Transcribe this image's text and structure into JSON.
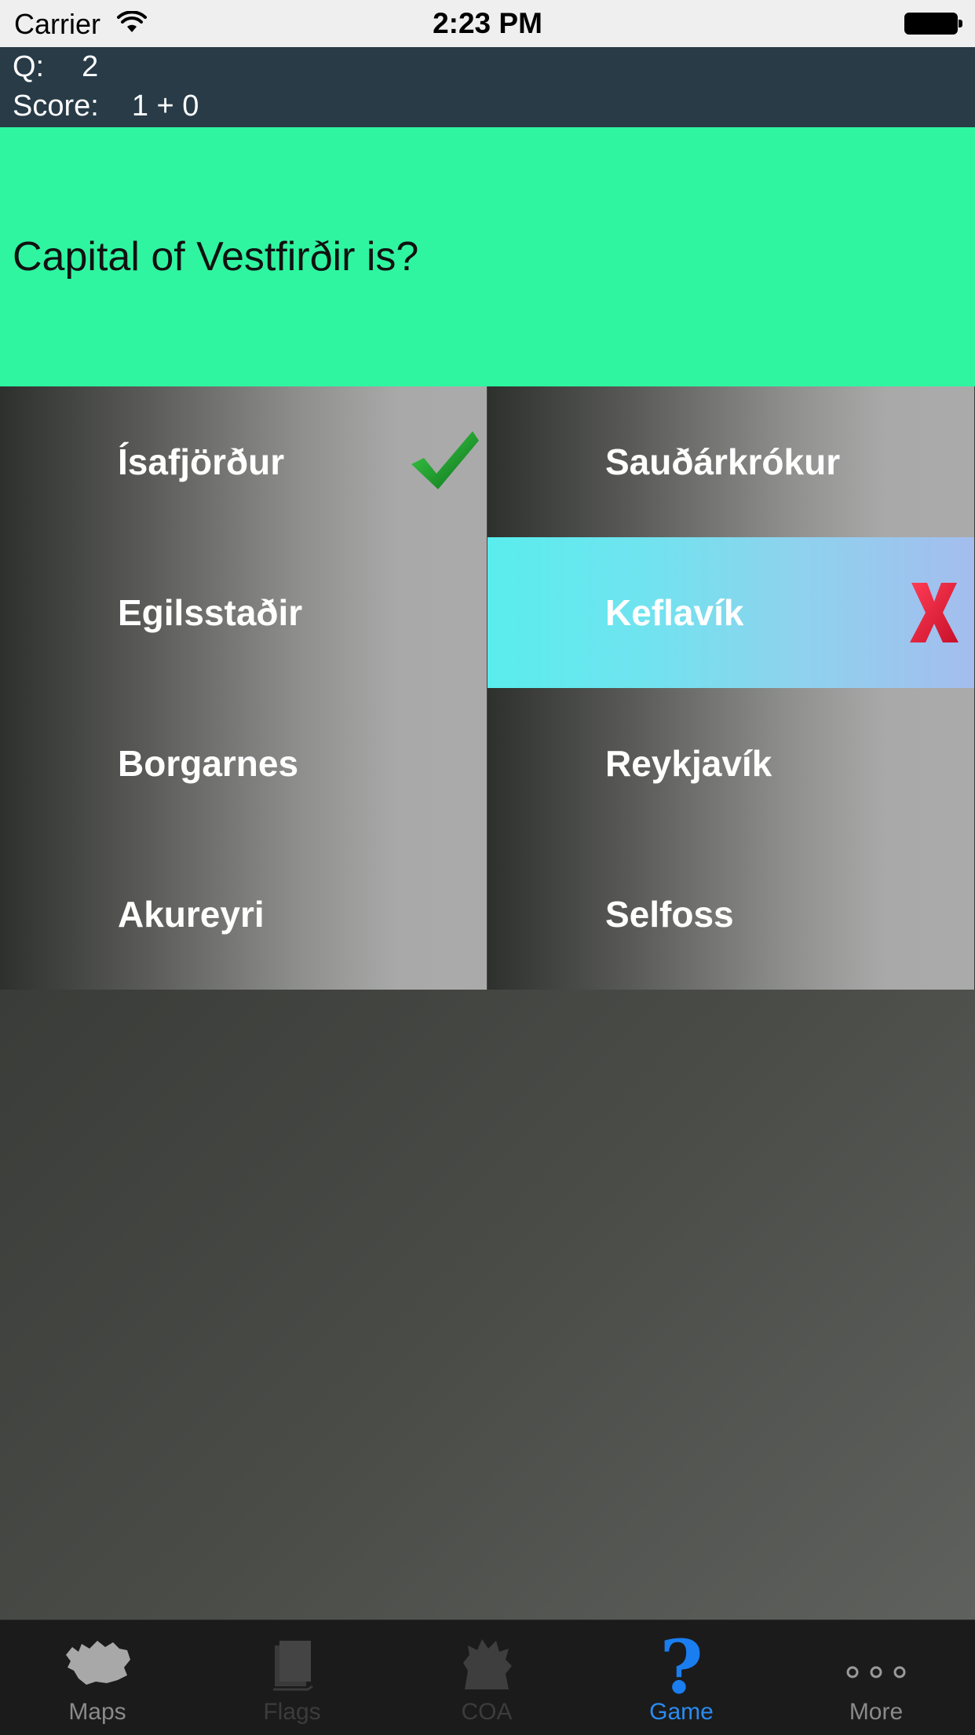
{
  "status_bar": {
    "carrier": "Carrier",
    "time": "2:23 PM",
    "wifi_icon": "wifi-icon",
    "battery_icon": "battery-icon"
  },
  "score_bar": {
    "question_label": "Q:",
    "question_number": "2",
    "score_label": "Score:",
    "score_value": "1 + 0"
  },
  "question": {
    "text": "Capital of Vestfirðir is?",
    "background": "#2ff5a0"
  },
  "answers": [
    {
      "label": "Ísafjörður",
      "state": "correct",
      "mark_icon": "checkmark-icon"
    },
    {
      "label": "Sauðárkrókur",
      "state": "normal"
    },
    {
      "label": "Egilsstaðir",
      "state": "normal"
    },
    {
      "label": "Keflavík",
      "state": "wrong",
      "mark_icon": "x-mark-icon"
    },
    {
      "label": "Borgarnes",
      "state": "normal"
    },
    {
      "label": "Reykjavík",
      "state": "normal"
    },
    {
      "label": "Akureyri",
      "state": "normal"
    },
    {
      "label": "Selfoss",
      "state": "normal"
    }
  ],
  "colors": {
    "correct_mark": "#1e9a2a",
    "wrong_mark": "#e8203a",
    "wrong_answer_bg": "#6ee4ef",
    "active_tab": "#2a8cf0",
    "score_bar_bg": "#283b47"
  },
  "tab_bar": {
    "tabs": [
      {
        "label": "Maps",
        "icon": "iceland-map-icon",
        "state": "normal"
      },
      {
        "label": "Flags",
        "icon": "flags-icon",
        "state": "disabled"
      },
      {
        "label": "COA",
        "icon": "coat-of-arms-icon",
        "state": "disabled"
      },
      {
        "label": "Game",
        "icon": "question-mark-icon",
        "state": "active"
      },
      {
        "label": "More",
        "icon": "more-dots-icon",
        "state": "normal"
      }
    ]
  }
}
